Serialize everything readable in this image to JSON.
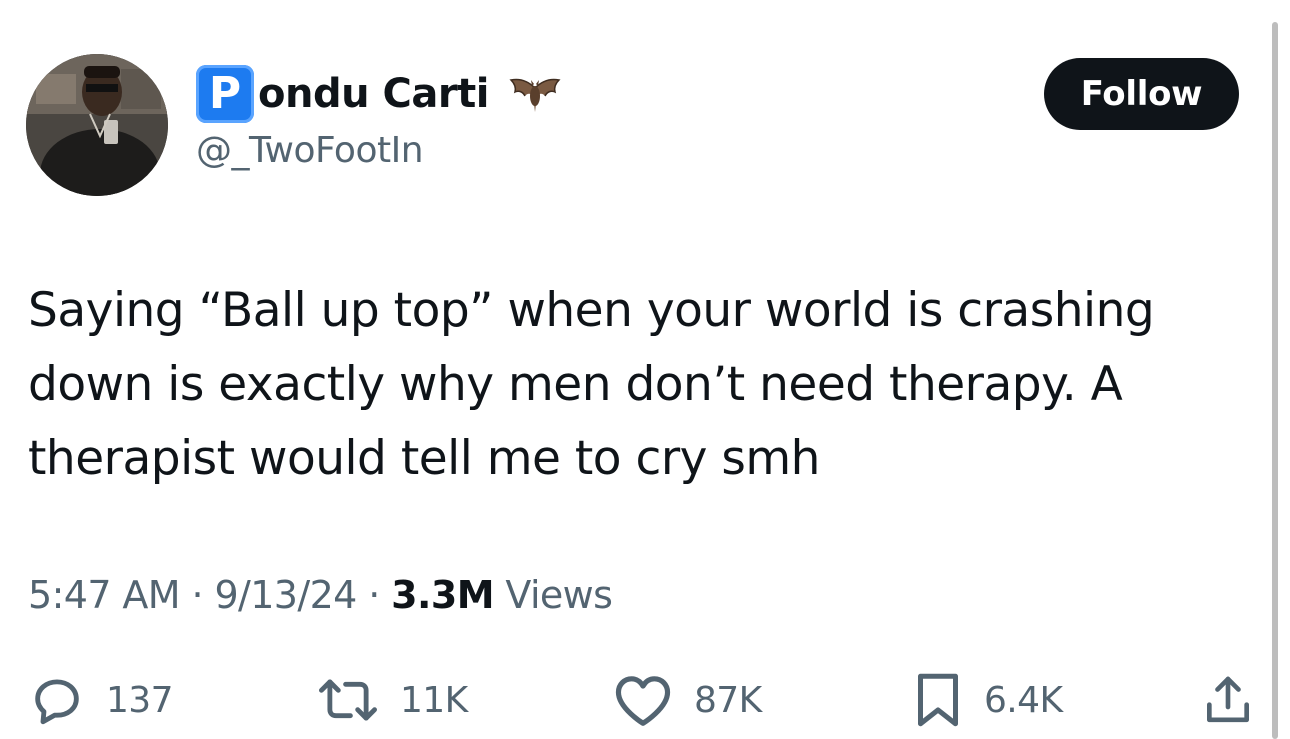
{
  "user": {
    "badge_letter": "P",
    "display_name": "ondu Carti",
    "handle": "@_TwoFootIn",
    "emoji_icon": "bat-emoji"
  },
  "follow_label": "Follow",
  "tweet": {
    "text": "Saying “Ball up top” when your world is crashing down is exactly why men don’t need therapy. A therapist would tell me to cry smh"
  },
  "meta": {
    "time": "5:47 AM",
    "sep1": " · ",
    "date": "9/13/24",
    "sep2": " · ",
    "views_count": "3.3M",
    "views_label": " Views"
  },
  "actions": {
    "replies": "137",
    "reposts": "11K",
    "likes": "87K",
    "bookmarks": "6.4K"
  },
  "colors": {
    "text_primary": "#0f1419",
    "text_secondary": "#536471",
    "badge_blue": "#1d7bf0",
    "button_bg": "#0f1419"
  }
}
